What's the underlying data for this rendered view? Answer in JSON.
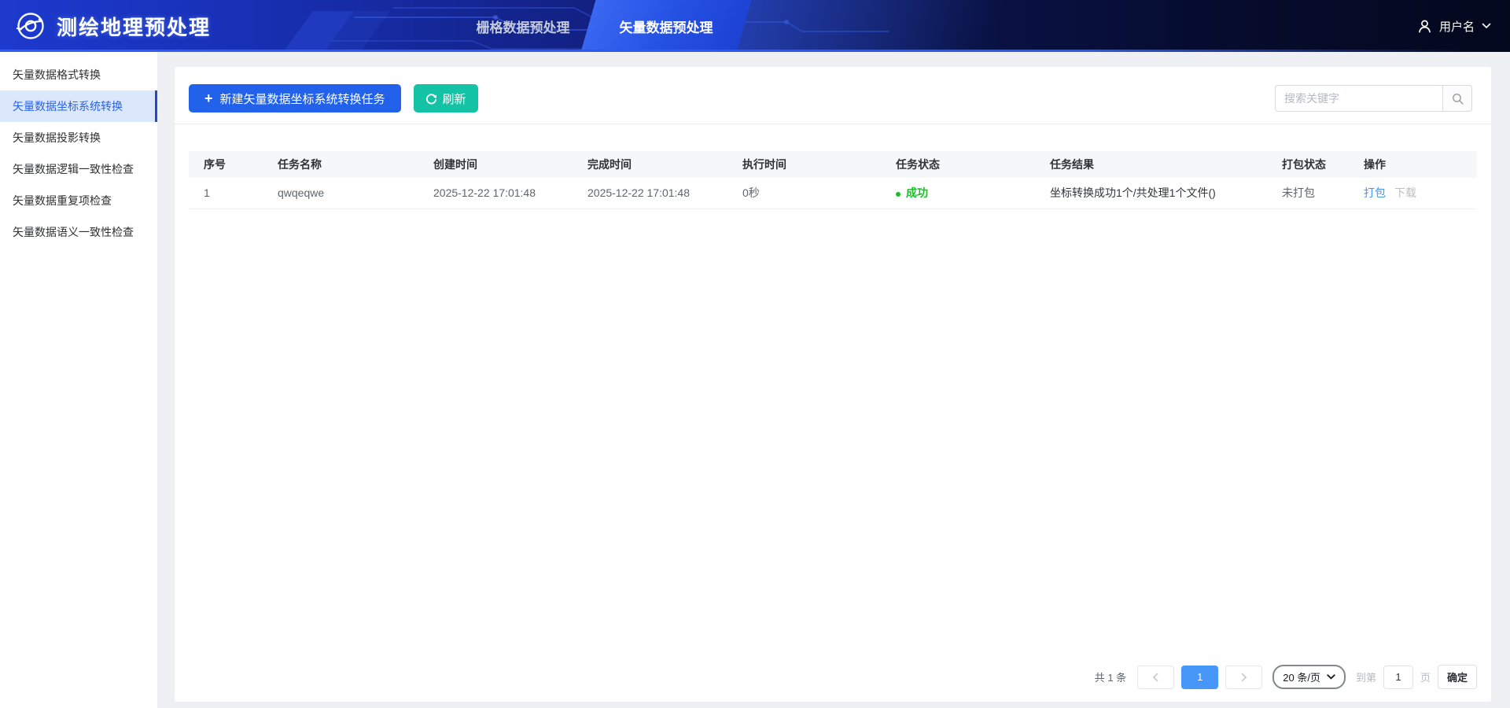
{
  "header": {
    "app_title": "测绘地理预处理",
    "tabs": [
      {
        "label": "栅格数据预处理",
        "active": false
      },
      {
        "label": "矢量数据预处理",
        "active": true
      }
    ],
    "user": {
      "name": "用户名"
    }
  },
  "sidebar": {
    "items": [
      {
        "label": "矢量数据格式转换"
      },
      {
        "label": "矢量数据坐标系统转换",
        "active": true
      },
      {
        "label": "矢量数据投影转换"
      },
      {
        "label": "矢量数据逻辑一致性检查"
      },
      {
        "label": "矢量数据重复项检查"
      },
      {
        "label": "矢量数据语义一致性检查"
      }
    ]
  },
  "toolbar": {
    "plus": "+",
    "new_task_label": "新建矢量数据坐标系统转换任务",
    "refresh_label": "刷新",
    "search_placeholder": "搜索关键字"
  },
  "table": {
    "headers": [
      "序号",
      "任务名称",
      "创建时间",
      "完成时间",
      "执行时间",
      "任务状态",
      "任务结果",
      "打包状态",
      "操作"
    ],
    "rows": [
      {
        "seq": "1",
        "name": "qwqeqwe",
        "created": "2025-12-22 17:01:48",
        "finished": "2025-12-22 17:01:48",
        "duration": "0秒",
        "status": "成功",
        "result": "坐标转换成功1个/共处理1个文件()",
        "package_state": "未打包",
        "action_package": "打包",
        "action_download": "下载"
      }
    ]
  },
  "pagination": {
    "total": "共 1 条",
    "current_page": "1",
    "page_size": "20 条/页",
    "goto_prefix": "到第",
    "goto_value": "1",
    "goto_suffix": "页",
    "confirm": "确定"
  },
  "colors": {
    "primary_button": "#2262ea",
    "refresh_button": "#14c3a5",
    "success_green": "#1abe29",
    "link_blue": "#3e97f5",
    "active_page_blue": "#4797f8",
    "sidebar_active_bg": "#dbe7fb",
    "header_dark": "#04081d"
  }
}
